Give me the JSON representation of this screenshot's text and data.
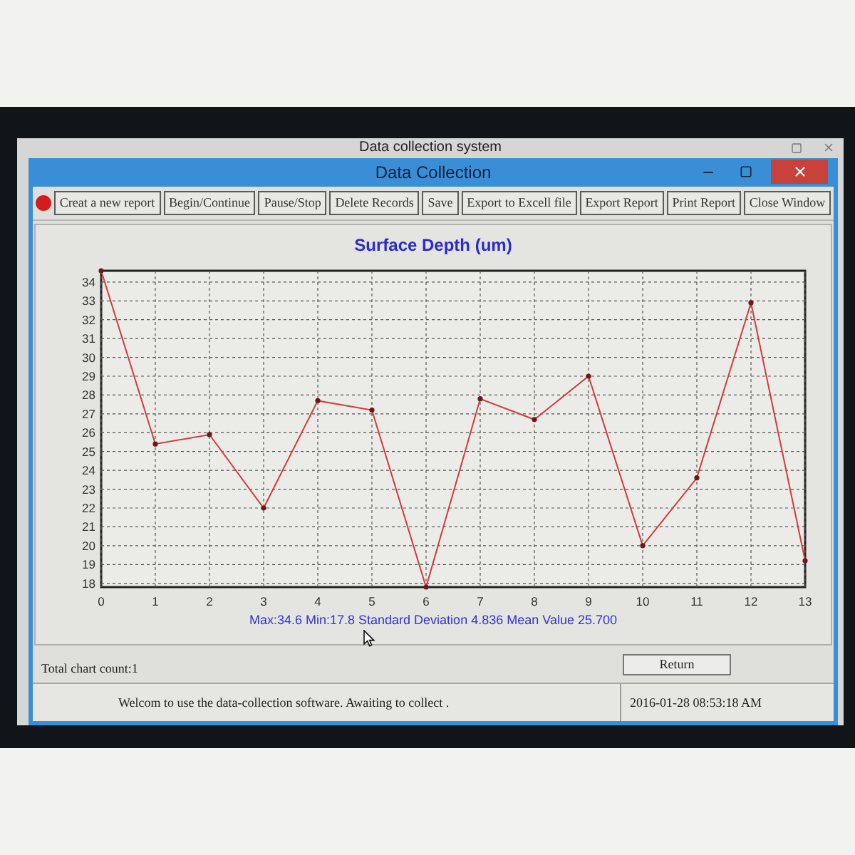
{
  "background_window": {
    "title": "Data collection system"
  },
  "window": {
    "title": "Data Collection"
  },
  "toolbar": {
    "buttons": [
      "Creat a new report",
      "Begin/Continue",
      "Pause/Stop",
      "Delete Records",
      "Save",
      "Export to Excell file",
      "Export Report",
      "Print Report",
      "Close Window"
    ]
  },
  "chart_panel": {
    "chart_data": {
      "type": "line",
      "title": "Surface Depth (um)",
      "grid": true,
      "x": [
        0,
        1,
        2,
        3,
        4,
        5,
        6,
        7,
        8,
        9,
        10,
        11,
        12,
        13
      ],
      "series": [
        {
          "color": "#d23c3c",
          "marker": "dot",
          "values": [
            34.6,
            25.4,
            25.9,
            22.0,
            27.7,
            27.2,
            17.8,
            27.8,
            26.7,
            29.0,
            20.0,
            23.6,
            32.9,
            19.2
          ]
        }
      ],
      "xlim": [
        0,
        13
      ],
      "ylim": [
        17.8,
        34.6
      ],
      "xticks": [
        0,
        1,
        2,
        3,
        4,
        5,
        6,
        7,
        8,
        9,
        10,
        11,
        12,
        13
      ],
      "yticks": [
        18,
        19,
        20,
        21,
        22,
        23,
        24,
        25,
        26,
        27,
        28,
        29,
        30,
        31,
        32,
        33,
        34
      ]
    },
    "stats": "Max:34.6 Min:17.8 Standard Deviation 4.836 Mean Value 25.700"
  },
  "summary": {
    "count": "Total chart count:1",
    "return_button": "Return"
  },
  "status_bar": {
    "message": "Welcom to use the data-collection software. Awaiting to collect .",
    "datetime": "2016-01-28 08:53:18 AM"
  }
}
